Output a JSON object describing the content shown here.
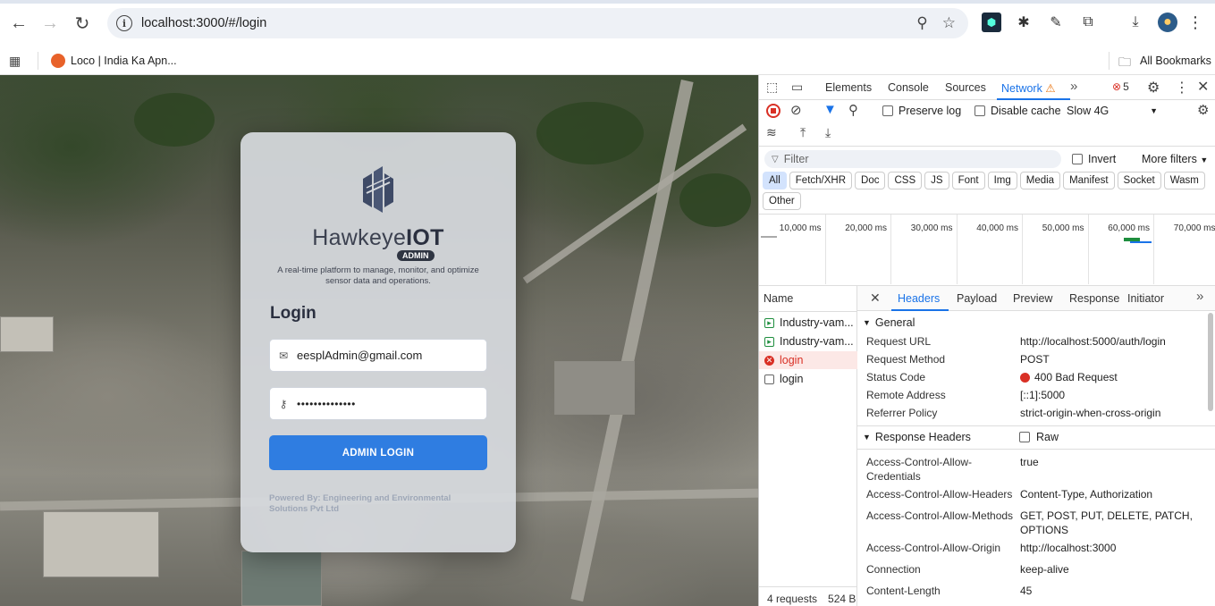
{
  "browser": {
    "url": "localhost:3000/#/login",
    "bookmark": "Loco | India Ka Apn...",
    "all_bookmarks": "All Bookmarks"
  },
  "login_page": {
    "brand_light": "Hawkeye",
    "brand_bold": "IOT",
    "badge": "ADMIN",
    "tagline": "A real-time platform to manage, monitor, and optimize sensor data and operations.",
    "title": "Login",
    "email_value": "eesplAdmin@gmail.com",
    "password_mask": "••••••••••••••",
    "button_label": "ADMIN LOGIN",
    "powered_by": "Powered By: Engineering and Environmental Solutions Pvt Ltd"
  },
  "devtools": {
    "tabs": [
      "Elements",
      "Console",
      "Sources",
      "Network"
    ],
    "active_tab": "Network",
    "error_count": "5",
    "preserve_log": "Preserve log",
    "disable_cache": "Disable cache",
    "throttle": "Slow 4G",
    "filter_placeholder": "Filter",
    "invert": "Invert",
    "more_filters": "More filters",
    "type_filters": [
      "All",
      "Fetch/XHR",
      "Doc",
      "CSS",
      "JS",
      "Font",
      "Img",
      "Media",
      "Manifest",
      "Socket",
      "Wasm",
      "Other"
    ],
    "timeline_ticks": [
      "10,000 ms",
      "20,000 ms",
      "30,000 ms",
      "40,000 ms",
      "50,000 ms",
      "60,000 ms",
      "70,000 ms"
    ],
    "name_header": "Name",
    "requests": [
      {
        "name": "Industry-vam...",
        "status": "doc"
      },
      {
        "name": "Industry-vam...",
        "status": "doc"
      },
      {
        "name": "login",
        "status": "error"
      },
      {
        "name": "login",
        "status": "none"
      }
    ],
    "footer_requests": "4 requests",
    "footer_size": "524 B",
    "detail_tabs": [
      "Headers",
      "Payload",
      "Preview",
      "Response",
      "Initiator"
    ],
    "general_title": "General",
    "general": [
      {
        "k": "Request URL",
        "v": "http://localhost:5000/auth/login"
      },
      {
        "k": "Request Method",
        "v": "POST"
      },
      {
        "k": "Status Code",
        "v": "400 Bad Request"
      },
      {
        "k": "Remote Address",
        "v": "[::1]:5000"
      },
      {
        "k": "Referrer Policy",
        "v": "strict-origin-when-cross-origin"
      }
    ],
    "response_headers_title": "Response Headers",
    "raw_label": "Raw",
    "response_headers": [
      {
        "k": "Access-Control-Allow-Credentials",
        "v": "true"
      },
      {
        "k": "Access-Control-Allow-Headers",
        "v": "Content-Type, Authorization"
      },
      {
        "k": "Access-Control-Allow-Methods",
        "v": "GET, POST, PUT, DELETE, PATCH, OPTIONS"
      },
      {
        "k": "Access-Control-Allow-Origin",
        "v": "http://localhost:3000"
      },
      {
        "k": "Connection",
        "v": "keep-alive"
      },
      {
        "k": "Content-Length",
        "v": "45"
      }
    ]
  },
  "colors": {
    "accent": "#2f7de1",
    "devtools_blue": "#1a73e8",
    "error_red": "#d93025"
  }
}
